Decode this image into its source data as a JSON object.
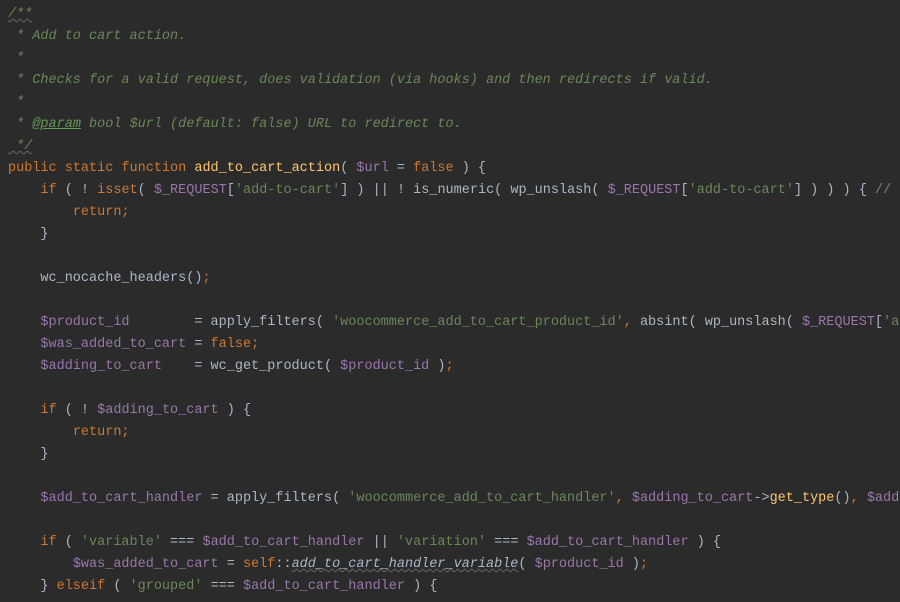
{
  "doc": {
    "open": "/**",
    "l1": " * Add to cart action.",
    "l2": " *",
    "l3a": " * Checks for a valid request, does validation (via hooks) and then redirects if valid.",
    "l4": " *",
    "l5pre": " * ",
    "l5tag": "@param",
    "l5rest": " bool $url (default: false) URL to redirect to.",
    "close": " */"
  },
  "code": {
    "kw_public": "public",
    "kw_static": "static",
    "kw_function": "function",
    "fn_name": "add_to_cart_action",
    "var_url": "$url",
    "eq": " = ",
    "false": "false",
    "kw_if": "if",
    "kw_isset": "isset",
    "var_request": "$_REQUEST",
    "str_add_to_cart": "'add-to-cart'",
    "fn_is_numeric": "is_numeric",
    "fn_wp_unslash": "wp_unslash",
    "cmt_phpcs": "// ph",
    "kw_return": "return",
    "fn_nocache": "wc_nocache_headers",
    "var_product_id": "$product_id",
    "fn_apply_filters": "apply_filters",
    "str_filter_pid": "'woocommerce_add_to_cart_product_id'",
    "fn_absint": "absint",
    "str_add_tail": "'add",
    "var_was_added": "$was_added_to_cart",
    "var_adding": "$adding_to_cart",
    "fn_wc_get_product": "wc_get_product",
    "var_handler": "$add_to_cart_handler",
    "str_filter_handler": "'woocommerce_add_to_cart_handler'",
    "fn_get_type": "get_type",
    "var_addin_tail": "$addin",
    "str_variable": "'variable'",
    "str_variation": "'variation'",
    "kw_self": "self",
    "fn_handler_variable": "add_to_cart_handler_variable",
    "kw_elseif": "elseif",
    "str_grouped": "'grouped'",
    "op_tripleeq": "===",
    "op_or": "||",
    "op_not": "!",
    "op_arrow": "->",
    "op_scope": "::"
  }
}
